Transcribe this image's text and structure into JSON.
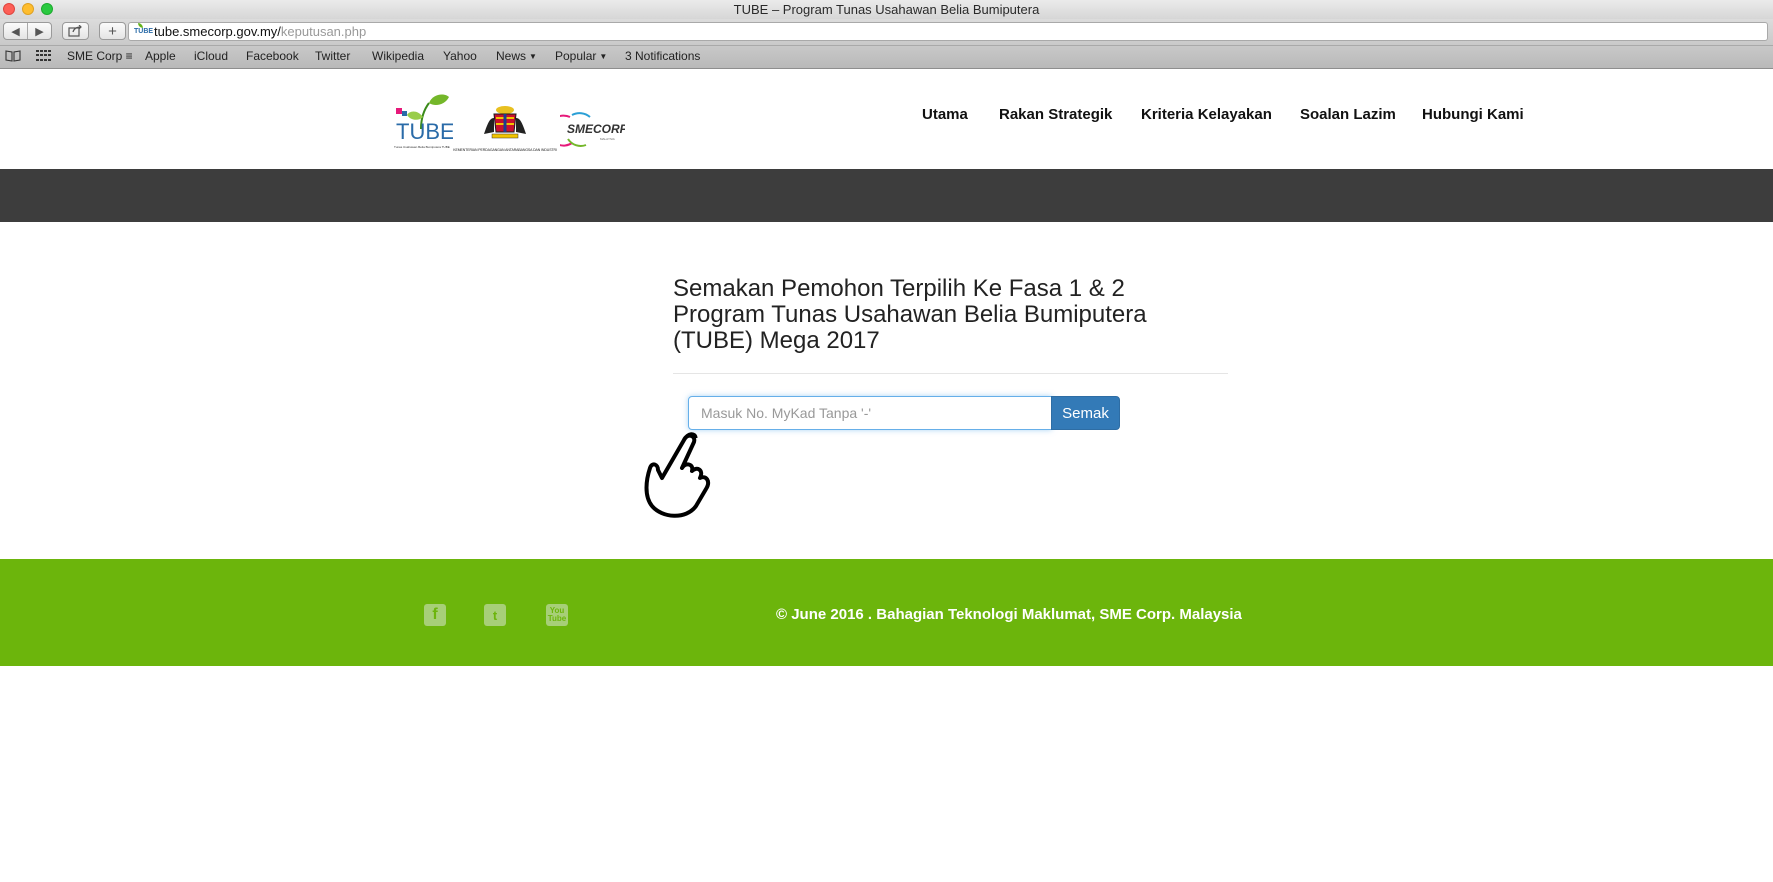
{
  "browser": {
    "window_title": "TUBE – Program Tunas Usahawan Belia Bumiputera",
    "url_domain": "tube.smecorp.gov.my/",
    "url_path": "keputusan.php",
    "back_icon": "back-arrow-icon",
    "forward_icon": "forward-arrow-icon",
    "share_icon": "share-icon",
    "add_icon": "plus-icon",
    "favicon_text": "TUBE",
    "bookmarks": [
      {
        "label": "SME Corp ≡"
      },
      {
        "label": "Apple"
      },
      {
        "label": "iCloud"
      },
      {
        "label": "Facebook"
      },
      {
        "label": "Twitter"
      },
      {
        "label": "Wikipedia"
      },
      {
        "label": "Yahoo"
      },
      {
        "label": "News"
      },
      {
        "label": "Popular"
      },
      {
        "label": "3 Notifications"
      }
    ]
  },
  "header": {
    "logo_tube_text": "TUBE",
    "logo_tube_tagline": "Tunas Usahawan Belia Bumiputera TUBE",
    "logo_ministry_text": "KEMENTERIAN PERDAGANGAN ANTARABANGSA DAN INDUSTRI",
    "logo_sme_text": "SMECORP",
    "logo_sme_sub": "MALAYSIA",
    "nav": [
      {
        "label": "Utama"
      },
      {
        "label": "Rakan Strategik"
      },
      {
        "label": "Kriteria Kelayakan"
      },
      {
        "label": "Soalan Lazim"
      },
      {
        "label": "Hubungi Kami"
      }
    ]
  },
  "main": {
    "heading_line1": "Semakan Pemohon Terpilih Ke Fasa 1 & 2",
    "heading_line2": "Program Tunas Usahawan Belia Bumiputera",
    "heading_line3": "(TUBE) Mega 2017",
    "mykad_placeholder": "Masuk No. MyKad Tanpa '-'",
    "mykad_value": "",
    "search_button": "Semak"
  },
  "footer": {
    "social": [
      {
        "icon": "facebook-icon",
        "glyph": "f"
      },
      {
        "icon": "twitter-icon",
        "glyph": "t"
      },
      {
        "icon": "youtube-icon",
        "glyph": "You Tube"
      }
    ],
    "copyright": "© June 2016 . Bahagian Teknologi Maklumat, SME Corp. Malaysia"
  },
  "colors": {
    "footer_green": "#6cb50c",
    "dark_band": "#3d3d3d",
    "button_blue": "#337ab7"
  }
}
